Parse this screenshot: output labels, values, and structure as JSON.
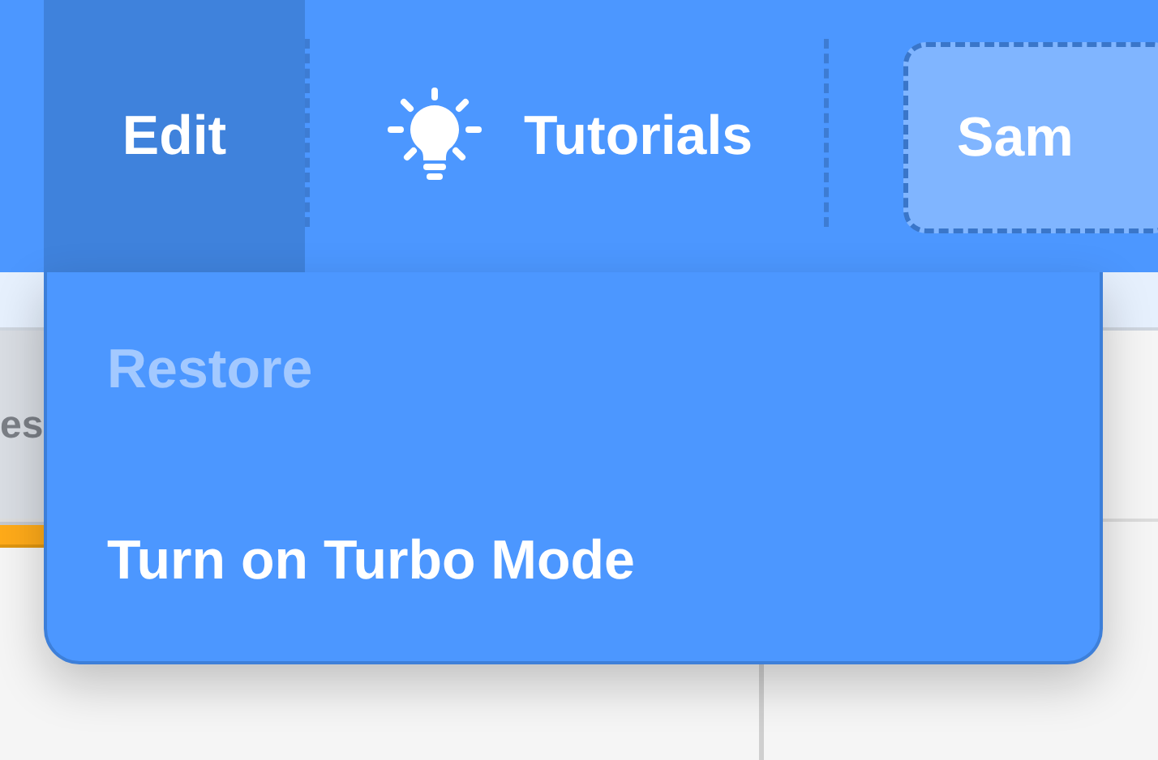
{
  "menu_bar": {
    "items": [
      {
        "kind": "menu",
        "label": "Edit",
        "selected": true
      },
      {
        "kind": "icon-menu",
        "label": "Tutorials",
        "selected": false
      },
      {
        "kind": "button",
        "label": "Sam",
        "selected": false
      }
    ]
  },
  "edit_menu": {
    "items": [
      {
        "label": "Restore",
        "disabled": true
      },
      {
        "label": "Turn on Turbo Mode",
        "disabled": false
      }
    ]
  },
  "background": {
    "tab_label": "es"
  }
}
